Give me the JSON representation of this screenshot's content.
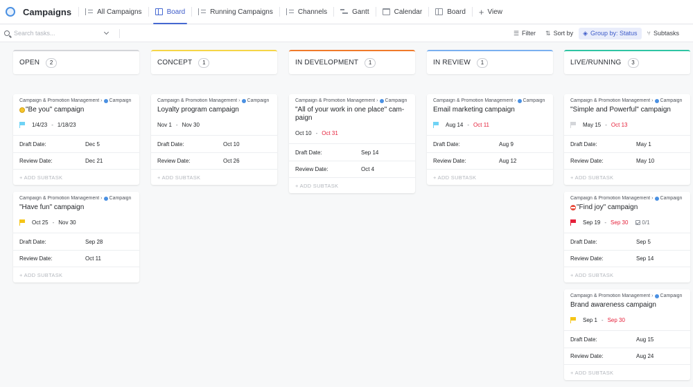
{
  "header": {
    "title": "Campaigns",
    "tabs": [
      {
        "label": "All Campaigns",
        "icon": "list-icon"
      },
      {
        "label": "Board",
        "icon": "board-icon",
        "active": true
      },
      {
        "label": "Running Campaigns",
        "icon": "list-icon"
      },
      {
        "label": "Channels",
        "icon": "list-icon"
      },
      {
        "label": "Gantt",
        "icon": "gantt-icon"
      },
      {
        "label": "Calendar",
        "icon": "calendar-icon"
      },
      {
        "label": "Board",
        "icon": "board-icon"
      }
    ],
    "add_view": "View"
  },
  "toolbar": {
    "search_placeholder": "Search tasks...",
    "filter": "Filter",
    "sort": "Sort by",
    "group": "Group by: Status",
    "subtasks": "Subtasks"
  },
  "labels": {
    "draft": "Draft Date:",
    "review": "Review Date:",
    "add_subtask": "+ ADD SUBTASK"
  },
  "colors": {
    "accent": "#4568d1",
    "overdue": "#e5203a"
  },
  "columns": [
    {
      "name": "OPEN",
      "count": "2",
      "color": "#d3d5d9",
      "cards": [
        {
          "crumb1": "Campaign & Promotion Management",
          "crumb2": "Campaign",
          "emoji": "smile",
          "title": "\"Be you\" campaign",
          "flag": "blue",
          "start": "1/4/23",
          "end": "1/18/23",
          "end_overdue": false,
          "draft": "Dec 5",
          "review": "Dec 21"
        },
        {
          "crumb1": "Campaign & Promotion Management",
          "crumb2": "Campaign",
          "title": "\"Have fun\" campaign",
          "flag": "yellow",
          "start": "Oct 25",
          "end": "Nov 30",
          "end_overdue": false,
          "draft": "Sep 28",
          "review": "Oct 11"
        }
      ]
    },
    {
      "name": "CONCEPT",
      "count": "1",
      "color": "#f5d547",
      "cards": [
        {
          "crumb1": "Campaign & Promotion Management",
          "crumb2": "Campaign",
          "title": "Loyalty program campaign",
          "flag": "",
          "start": "Nov 1",
          "end": "Nov 30",
          "end_overdue": false,
          "draft": "Oct 10",
          "review": "Oct 26"
        }
      ]
    },
    {
      "name": "IN DEVELOPMENT",
      "count": "1",
      "color": "#f07a2a",
      "cards": [
        {
          "crumb1": "Campaign & Promotion Management",
          "crumb2": "Campaign",
          "title": "\"All of your work in one place\" cam-paign",
          "flag": "",
          "start": "Oct 10",
          "end": "Oct 31",
          "end_overdue": true,
          "draft": "Sep 14",
          "review": "Oct 4"
        }
      ]
    },
    {
      "name": "IN REVIEW",
      "count": "1",
      "color": "#7ab0f0",
      "cards": [
        {
          "crumb1": "Campaign & Promotion Management",
          "crumb2": "Campaign",
          "title": "Email marketing campaign",
          "flag": "blue",
          "start": "Aug 14",
          "end": "Oct 11",
          "end_overdue": true,
          "draft": "Aug 9",
          "review": "Aug 12"
        }
      ]
    },
    {
      "name": "LIVE/RUNNING",
      "count": "3",
      "color": "#2ec4a3",
      "cards": [
        {
          "crumb1": "Campaign & Promotion Management",
          "crumb2": "Campaign",
          "title": "\"Simple and Powerful\" campaign",
          "flag": "gray",
          "start": "May 15",
          "end": "Oct 13",
          "end_overdue": true,
          "draft": "May 1",
          "review": "May 10"
        },
        {
          "crumb1": "Campaign & Promotion Management",
          "crumb2": "Campaign",
          "emoji": "nope",
          "title": "\"Find joy\" campaign",
          "flag": "red",
          "start": "Sep 19",
          "end": "Sep 30",
          "end_overdue": true,
          "checklist": "0/1",
          "draft": "Sep 5",
          "review": "Sep 14"
        },
        {
          "crumb1": "Campaign & Promotion Management",
          "crumb2": "Campaign",
          "title": "Brand awareness campaign",
          "flag": "yellow",
          "start": "Sep 1",
          "end": "Sep 30",
          "end_overdue": true,
          "draft": "Aug 15",
          "review": "Aug 24"
        }
      ]
    }
  ]
}
